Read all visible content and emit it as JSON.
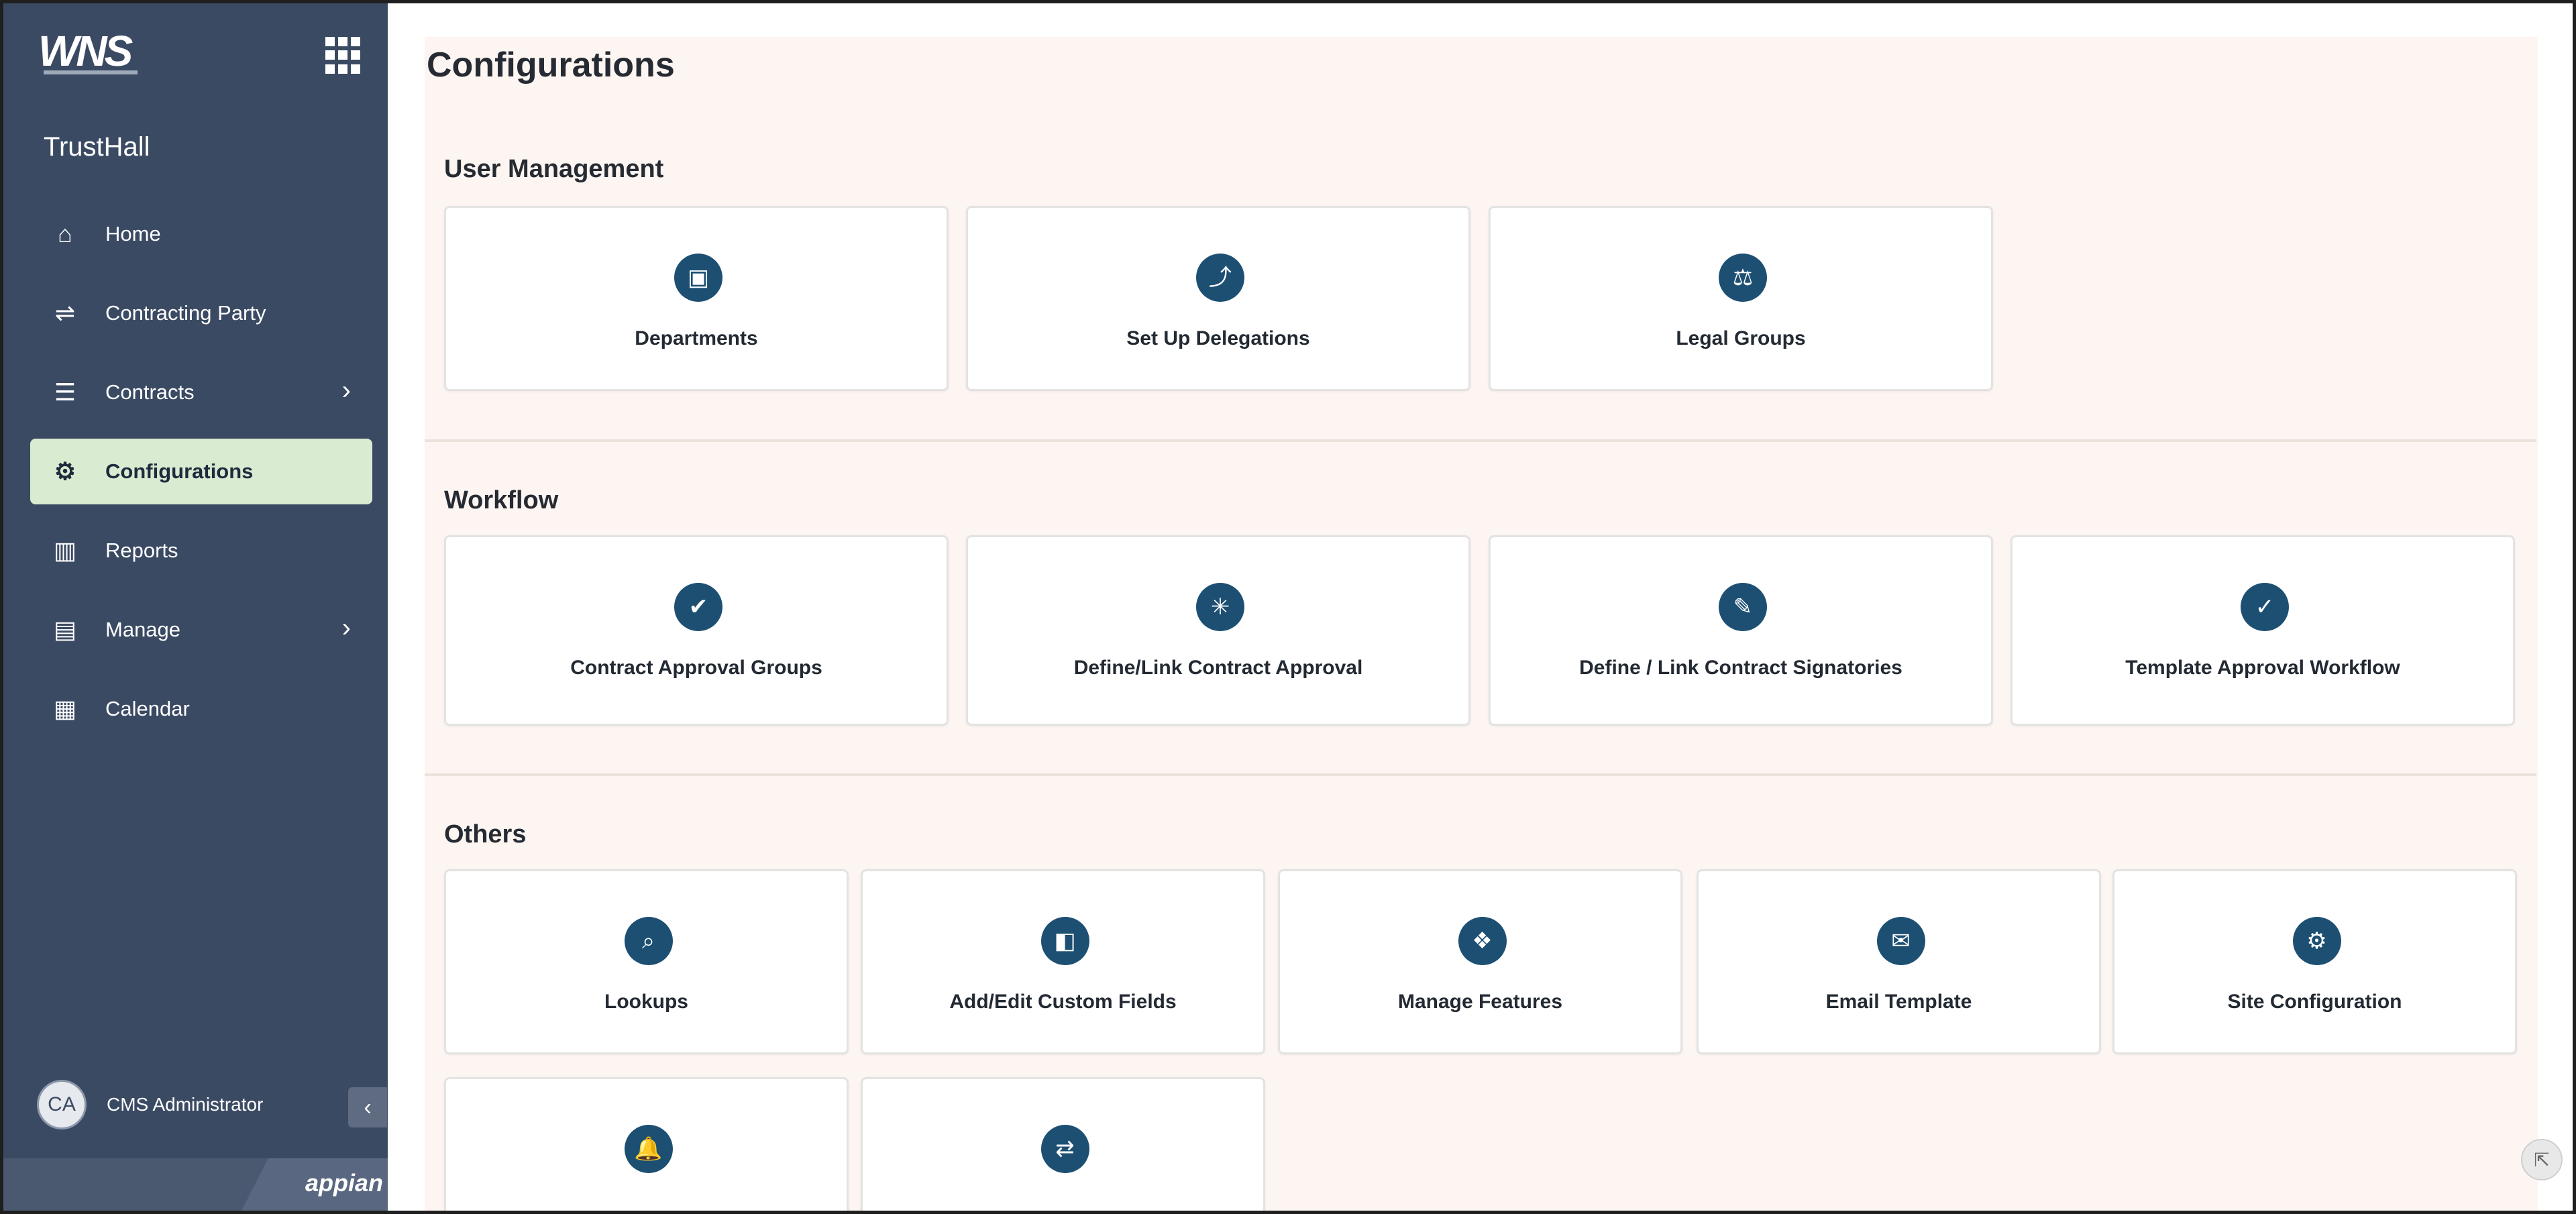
{
  "sidebar": {
    "logo": "WNS",
    "brand": "TrustHall",
    "items": [
      {
        "label": "Home",
        "icon": "home-icon",
        "glyph": "⌂",
        "active": false,
        "chevron": false
      },
      {
        "label": "Contracting Party",
        "icon": "handshake-icon",
        "glyph": "⇌",
        "active": false,
        "chevron": false
      },
      {
        "label": "Contracts",
        "icon": "list-icon",
        "glyph": "☰",
        "active": false,
        "chevron": true
      },
      {
        "label": "Configurations",
        "icon": "gear-icon",
        "glyph": "⚙",
        "active": true,
        "chevron": false
      },
      {
        "label": "Reports",
        "icon": "bar-chart-icon",
        "glyph": "▥",
        "active": false,
        "chevron": false
      },
      {
        "label": "Manage",
        "icon": "document-icon",
        "glyph": "▤",
        "active": false,
        "chevron": true
      },
      {
        "label": "Calendar",
        "icon": "calendar-icon",
        "glyph": "▦",
        "active": false,
        "chevron": false
      }
    ],
    "chevron_glyph": "›",
    "user": {
      "initials": "CA",
      "name": "CMS Administrator"
    },
    "collapse_glyph": "‹",
    "powered_by": "appian"
  },
  "main": {
    "title": "Configurations",
    "sections": [
      {
        "title": "User Management",
        "cards": [
          {
            "label": "Departments",
            "icon": "building-icon",
            "glyph": "▣"
          },
          {
            "label": "Set Up Delegations",
            "icon": "delegation-icon",
            "glyph": "⤴"
          },
          {
            "label": "Legal Groups",
            "icon": "group-icon",
            "glyph": "⚖"
          }
        ]
      },
      {
        "title": "Workflow",
        "cards": [
          {
            "label": "Contract Approval Groups",
            "icon": "approval-group-icon",
            "glyph": "✔"
          },
          {
            "label": "Define/Link Contract Approval",
            "icon": "link-icon",
            "glyph": "✳"
          },
          {
            "label": "Define / Link Contract Signatories",
            "icon": "signature-icon",
            "glyph": "✎"
          },
          {
            "label": "Template Approval Workflow",
            "icon": "template-icon",
            "glyph": "✓"
          }
        ]
      },
      {
        "title": "Others",
        "cards": [
          {
            "label": "Lookups",
            "icon": "magnifier-icon",
            "glyph": "⌕"
          },
          {
            "label": "Add/Edit Custom Fields",
            "icon": "custom-fields-icon",
            "glyph": "◧"
          },
          {
            "label": "Manage Features",
            "icon": "features-icon",
            "glyph": "❖"
          },
          {
            "label": "Email Template",
            "icon": "email-icon",
            "glyph": "✉"
          },
          {
            "label": "Site Configuration",
            "icon": "site-config-icon",
            "glyph": "⚙"
          },
          {
            "label": "",
            "icon": "notification-icon",
            "glyph": "🔔"
          },
          {
            "label": "",
            "icon": "contract-icon",
            "glyph": "⇄"
          }
        ]
      }
    ]
  },
  "colors": {
    "sidebar_bg": "#3b4a63",
    "active_item_bg": "#d9ecd2",
    "card_icon_bg": "#1d4f73",
    "content_bg": "#fdf5f1"
  }
}
